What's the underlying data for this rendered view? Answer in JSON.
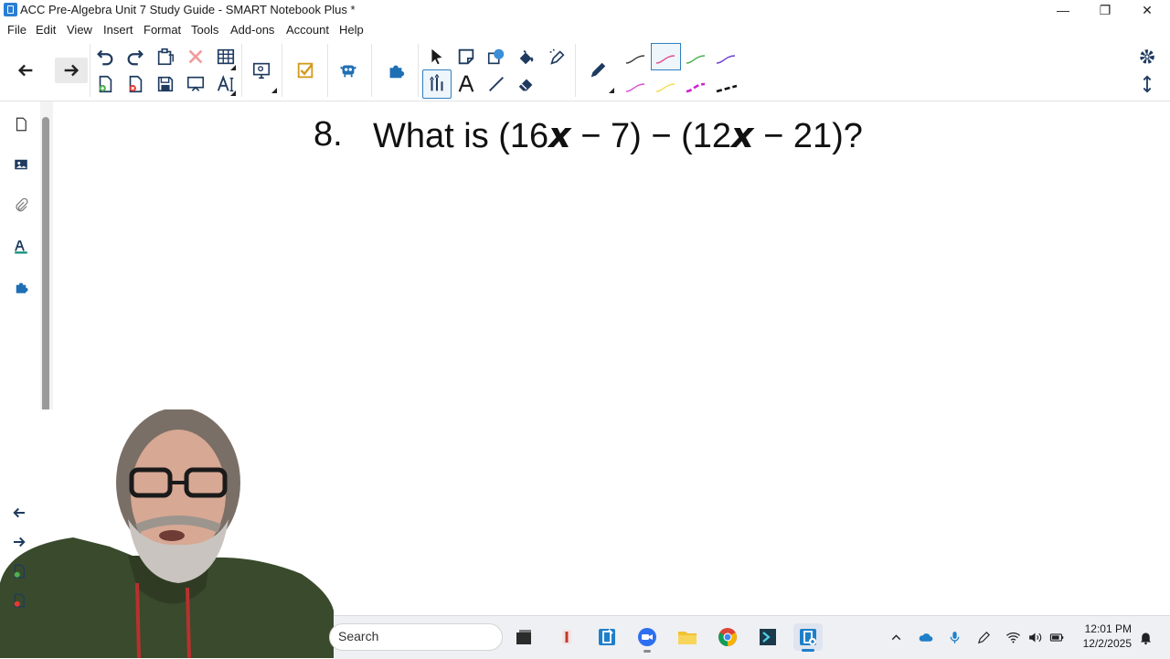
{
  "window": {
    "title": "ACC Pre-Algebra Unit 7 Study Guide - SMART Notebook Plus *",
    "controls": {
      "minimize": "—",
      "restore": "❐",
      "close": "✕"
    }
  },
  "menu": [
    "File",
    "Edit",
    "View",
    "Insert",
    "Format",
    "Tools",
    "Add-ons",
    "Account",
    "Help"
  ],
  "toolbar": {
    "icons": [
      "back-arrow-icon",
      "forward-arrow-icon",
      "undo-icon",
      "redo-icon",
      "paste-icon",
      "delete-icon",
      "table-icon",
      "add-page-icon",
      "delete-page-icon",
      "save-icon",
      "show-screen-icon",
      "text-style-icon",
      "display-icon",
      "activity-builder-icon",
      "monster-icon",
      "add-ons-icon",
      "select-icon",
      "sticky-note-icon",
      "shapes-icon",
      "fill-icon",
      "magic-pen-icon",
      "pen-select-icon",
      "text-icon",
      "line-icon",
      "eraser-icon",
      "pen-icon"
    ],
    "pen_colors": [
      "#3a3a3a",
      "#e0508a",
      "#4caf50",
      "#6a3dd6",
      "#d84fd8",
      "#f0e050",
      "#d020d0",
      "#111111"
    ],
    "selected_pen_index": 1
  },
  "sidebar": {
    "tabs": [
      "page-sorter-icon",
      "gallery-icon",
      "attachments-icon",
      "properties-icon",
      "add-ons-icon"
    ],
    "bottom": [
      "previous-page-icon",
      "next-page-icon",
      "add-page-icon",
      "delete-page-icon"
    ]
  },
  "canvas": {
    "question_number": "8.",
    "question_text": "What is (16𝙭 − 7) − (12𝙭 − 21)?"
  },
  "taskbar": {
    "search_placeholder": "Search",
    "apps": [
      "task-view-icon",
      "app-icon",
      "smart-notebook-icon",
      "zoom-icon",
      "file-explorer-icon",
      "chrome-icon",
      "terminal-icon",
      "notebook-plus-icon"
    ],
    "tray": [
      "chevron-up-icon",
      "onedrive-icon",
      "microphone-icon",
      "pen-icon",
      "wifi-icon",
      "volume-icon",
      "battery-icon",
      "notification-icon"
    ],
    "time": "12:01 PM",
    "date": "12/2/2025"
  }
}
